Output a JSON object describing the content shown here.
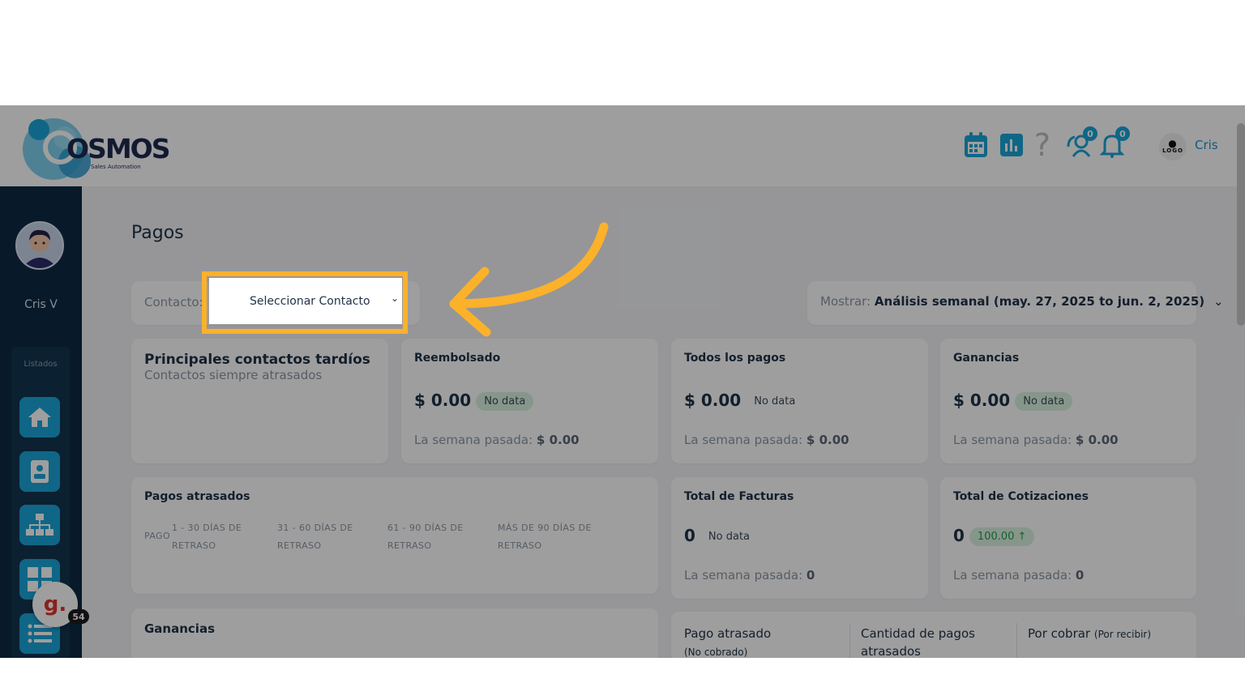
{
  "header": {
    "logo_text": "OSMOS",
    "logo_sub": "Sales Automation",
    "icons": [
      "calendar-icon",
      "bar-chart-icon",
      "help-icon",
      "user-sync-icon",
      "bell-icon"
    ],
    "user_sync_badge": "0",
    "bell_badge": "0",
    "company_logo": "LOGO",
    "user_name": "Cris"
  },
  "sidebar": {
    "user_name": "Cris V",
    "section_label": "Listados",
    "items": [
      "home-icon",
      "contact-card-icon",
      "org-chart-icon",
      "grid-icon",
      "list-icon"
    ],
    "chat_badge": "54",
    "chat_logo": "g."
  },
  "page": {
    "title": "Pagos",
    "filter": {
      "label": "Contacto:",
      "select_value": "Seleccionar Contacto"
    },
    "show": {
      "label": "Mostrar:",
      "value": "Análisis semanal (may. 27, 2025 to jun. 2, 2025)"
    }
  },
  "cards": {
    "late_contacts": {
      "title": "Principales contactos tardíos",
      "subtitle": "Contactos siempre atrasados"
    },
    "refunded": {
      "title": "Reembolsado",
      "amount": "$ 0.00",
      "pill": "No data",
      "last_week_label": "La semana pasada:",
      "last_week_value": "$ 0.00"
    },
    "all_payments": {
      "title": "Todos los pagos",
      "amount": "$ 0.00",
      "pill": "No data",
      "last_week_label": "La semana pasada:",
      "last_week_value": "$ 0.00"
    },
    "earnings": {
      "title": "Ganancias",
      "amount": "$ 0.00",
      "pill": "No data",
      "last_week_label": "La semana pasada:",
      "last_week_value": "$ 0.00"
    },
    "late_payments": {
      "title": "Pagos atrasados",
      "columns": [
        "PAGO",
        "1 - 30 DÍAS DE RETRASO",
        "31 - 60 DÍAS DE RETRASO",
        "61 - 90 DÍAS DE RETRASO",
        "MÁS DE 90 DÍAS DE RETRASO"
      ]
    },
    "total_invoices": {
      "title": "Total de Facturas",
      "amount": "0",
      "pill": "No data",
      "last_week_label": "La semana pasada:",
      "last_week_value": "0"
    },
    "total_quotes": {
      "title": "Total de Cotizaciones",
      "amount": "0",
      "pill": "100.00 ↑",
      "last_week_label": "La semana pasada:",
      "last_week_value": "0"
    },
    "earnings_chart": {
      "title": "Ganancias"
    },
    "summary": {
      "late_payment": "Pago atrasado",
      "late_payment_sub": "(No cobrado)",
      "late_count": "Cantidad de pagos atrasados",
      "receivable": "Por cobrar",
      "receivable_sub": "(Por recibir)"
    }
  },
  "colors": {
    "accent": "#1aa5d9",
    "sidebar": "#0d2b45",
    "highlight": "#fbb12a"
  }
}
